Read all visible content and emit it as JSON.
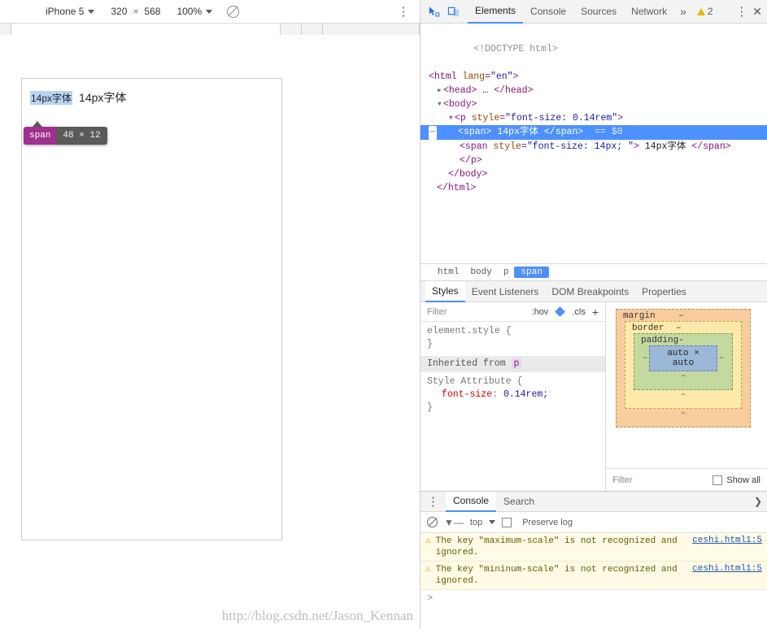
{
  "device_toolbar": {
    "device_name": "iPhone 5",
    "width": "320",
    "height": "568",
    "times": "×",
    "zoom": "100%",
    "rotate_icon": "no-throttling-icon",
    "more_icon": "vertical-dots-icon"
  },
  "viewport": {
    "highlighted_text": "14px字体",
    "plain_text": "14px字体",
    "tooltip": {
      "tag": "span",
      "size": "48 × 12"
    }
  },
  "watermark": "http://blog.csdn.net/Jason_Kennan",
  "devtools": {
    "inspect_icon": "inspect-cursor-icon",
    "device_icon": "device-toolbar-icon",
    "tabs": [
      {
        "label": "Elements",
        "selected": true
      },
      {
        "label": "Console",
        "selected": false
      },
      {
        "label": "Sources",
        "selected": false
      },
      {
        "label": "Network",
        "selected": false
      }
    ],
    "tabs_overflow": "»",
    "warning_count": "2",
    "more_icon": "vertical-dots-icon",
    "close_icon": "close-icon"
  },
  "dom": {
    "lines": [
      {
        "indent": 0,
        "kind": "doctype",
        "text": "<!DOCTYPE html>"
      },
      {
        "indent": 0,
        "kind": "open",
        "tag": "html",
        "attr": "lang",
        "value": "\"en\""
      },
      {
        "indent": 1,
        "kind": "collapsed",
        "tag": "head",
        "text": "<head> … </head>"
      },
      {
        "indent": 1,
        "kind": "open",
        "tag": "body"
      },
      {
        "indent": 2,
        "kind": "open_attr",
        "tag": "p",
        "attr": "style",
        "value": "\"font-size: 0.14rem\""
      },
      {
        "indent": 3,
        "kind": "selected",
        "tag": "span",
        "text": "14px字体",
        "suffix": "== $0"
      },
      {
        "indent": 3,
        "kind": "span_styled",
        "tag": "span",
        "attr": "style",
        "value": "\"font-size: 14px; \"",
        "text": "14px字体"
      },
      {
        "indent": 3,
        "kind": "close",
        "tag": "p"
      },
      {
        "indent": 2,
        "kind": "close",
        "tag": "body"
      },
      {
        "indent": 1,
        "kind": "close",
        "tag": "html"
      }
    ]
  },
  "breadcrumb": [
    {
      "label": "html",
      "active": false
    },
    {
      "label": "body",
      "active": false
    },
    {
      "label": "p",
      "active": false
    },
    {
      "label": "span",
      "active": true
    }
  ],
  "styles_pane": {
    "tabs": [
      {
        "label": "Styles",
        "selected": true
      },
      {
        "label": "Event Listeners",
        "selected": false
      },
      {
        "label": "DOM Breakpoints",
        "selected": false
      },
      {
        "label": "Properties",
        "selected": false
      }
    ],
    "filter_placeholder": "Filter",
    "hov_label": ":hov",
    "cls_label": ".cls",
    "plus_label": "+",
    "rules": [
      {
        "selector": "element.style {",
        "declarations": [],
        "close": "}"
      }
    ],
    "inherited_from_label": "Inherited from",
    "inherited_from_chip": "p",
    "inherited_rule": {
      "selector": "Style Attribute {",
      "property": "font-size",
      "value": "0.14rem;",
      "close": "}"
    },
    "box_model": {
      "margin_label": "margin",
      "margin_value": "–",
      "border_label": "border",
      "border_value": "–",
      "padding_label": "padding-",
      "content": "auto × auto",
      "dash": "–"
    },
    "computed_filter_placeholder": "Filter",
    "show_all_label": "Show all"
  },
  "drawer": {
    "menu_icon": "vertical-dots-icon",
    "tabs": [
      {
        "label": "Console",
        "selected": true
      },
      {
        "label": "Search",
        "selected": false
      }
    ],
    "close_icon": "chevron-right-icon",
    "toolbar": {
      "clear_icon": "clear-console-icon",
      "filter_icon": "filter-icon",
      "context": "top",
      "caret_icon": "chevron-down-icon",
      "preserve_log_label": "Preserve log"
    },
    "messages": [
      {
        "level": "warning",
        "text": "The key \"maximum-scale\" is not recognized and ignored.",
        "source": "ceshi.html1:5"
      },
      {
        "level": "warning",
        "text": "The key \"mininum-scale\" is not recognized and ignored.",
        "source": "ceshi.html1:5"
      }
    ],
    "prompt": ">"
  },
  "colors": {
    "accent": "#4d90fe",
    "selected_tab_underline": "#4d8ff7",
    "tag_badge": "#a0318f",
    "warning": "#f5b400",
    "margin_box": "#f9cc9d",
    "border_box": "#fde9a9",
    "padding_box": "#c4d9a0",
    "content_box": "#9cb8d8"
  }
}
